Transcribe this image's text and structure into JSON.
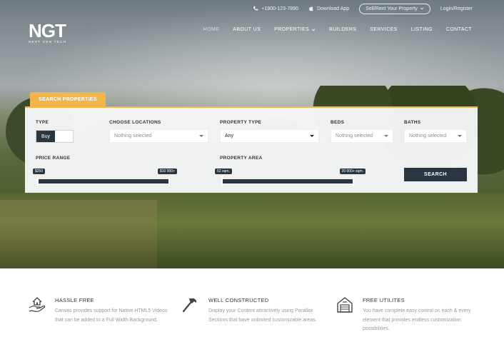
{
  "topbar": {
    "phone": "+1800-123-7890",
    "download": "Download App",
    "sell_rent": "Sell/Rent Your Property",
    "login": "Login/Register"
  },
  "logo": {
    "mark": "NGT",
    "subtitle": "NEXT GEN TECH"
  },
  "nav": {
    "items": [
      {
        "label": "HOME"
      },
      {
        "label": "ABOUT US"
      },
      {
        "label": "PROPERTIES"
      },
      {
        "label": "BUILDERS"
      },
      {
        "label": "SERVICES"
      },
      {
        "label": "LISTING"
      },
      {
        "label": "CONTACT"
      }
    ]
  },
  "search": {
    "tab_label": "SEARCH PROPERTIES",
    "type_label": "TYPE",
    "type_value": "Buy",
    "location_label": "CHOOSE LOCATIONS",
    "location_value": "Nothing selected",
    "property_type_label": "PROPERTY TYPE",
    "property_type_value": "Any",
    "beds_label": "BEDS",
    "beds_value": "Nothing selected",
    "baths_label": "BATHS",
    "baths_value": "Nothing selected",
    "price_label": "PRICE RANGE",
    "price_min": "$250",
    "price_max": "$10 000+",
    "area_label": "PROPERTY AREA",
    "area_min": "52 sqm.",
    "area_max": "20 000+ sqm.",
    "button_label": "SEARCH"
  },
  "features": [
    {
      "icon": "hand-house-icon",
      "title": "HASSLE FREE",
      "desc": "Canvas provides support for Native HTML5 Videos that can be added to a Full Width Background."
    },
    {
      "icon": "hammer-icon",
      "title": "WELL CONSTRUCTED",
      "desc": "Display your Content attractively using Parallax Sections that have unlimited customizable areas."
    },
    {
      "icon": "garage-icon",
      "title": "FREE UTILITES",
      "desc": "You have complete easy control on each & every element that provides endless customization possibilities."
    }
  ],
  "colors": {
    "accent": "#f2b54a",
    "dark": "#2b3643"
  }
}
